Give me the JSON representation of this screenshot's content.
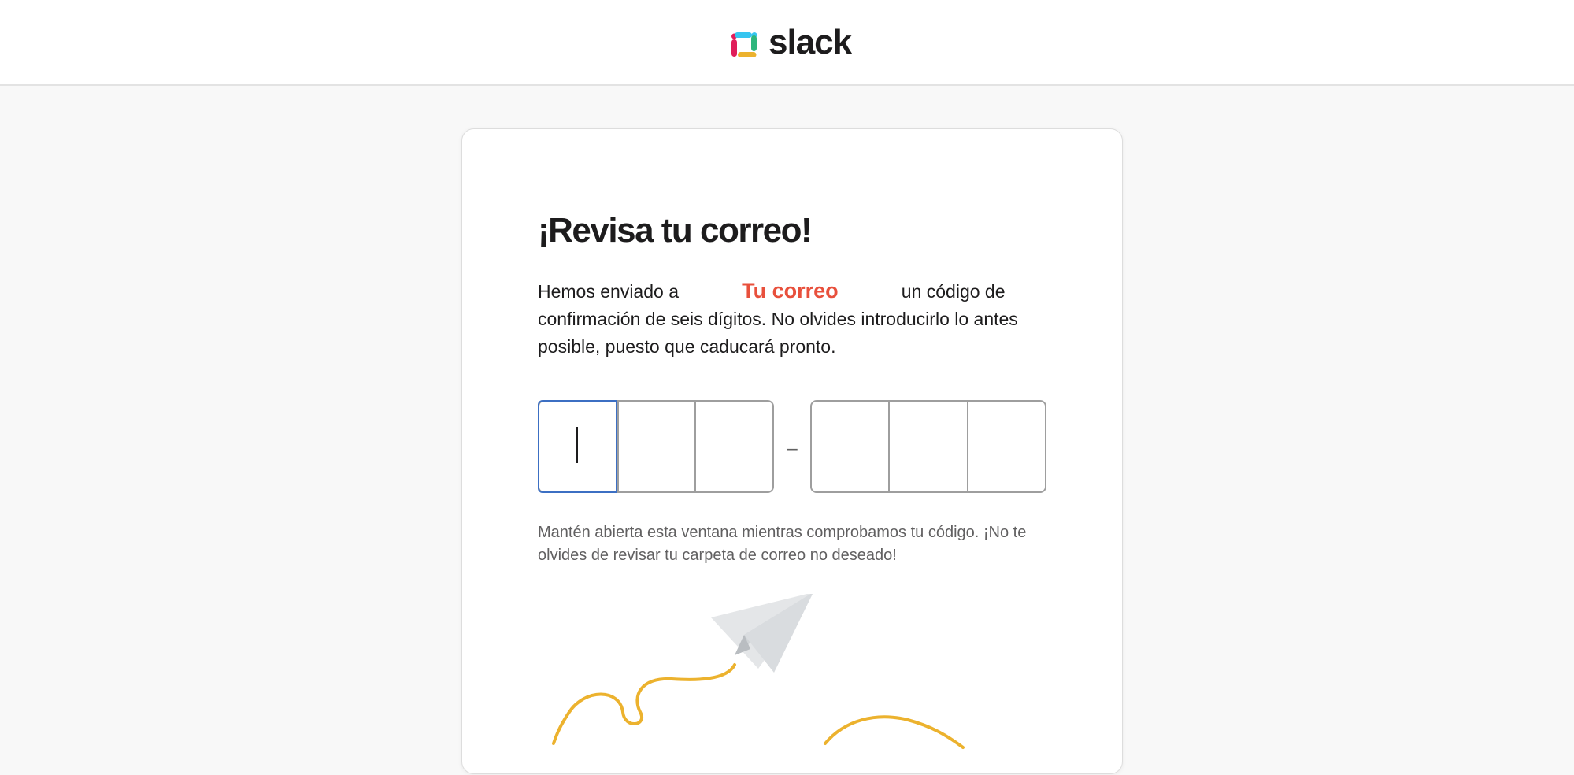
{
  "header": {
    "brand_name": "slack",
    "logo_icon": "slack-logo-icon",
    "logo_colors": {
      "blue": "#36c5f0",
      "green": "#2eb67d",
      "red": "#e01e5a",
      "yellow": "#ecb22e"
    }
  },
  "card": {
    "title": "¡Revisa tu correo!",
    "description_before": "Hemos enviado a",
    "email_label": "Tu correo",
    "description_after": "un código de confirmación de seis dígitos. No olvides introducirlo lo antes posible, puesto que caducará pronto.",
    "code": {
      "digits": [
        "",
        "",
        "",
        "",
        "",
        ""
      ],
      "separator": "–"
    },
    "note": "Mantén abierta esta ventana mientras comprobamos tu código. ¡No te olvides de revisar tu carpeta de correo no deseado!",
    "illustration_icon": "paper-plane-icon"
  },
  "colors": {
    "accent_focus": "#3c6fc3",
    "email_highlight": "#e8503c",
    "trail": "#ecb22e"
  }
}
